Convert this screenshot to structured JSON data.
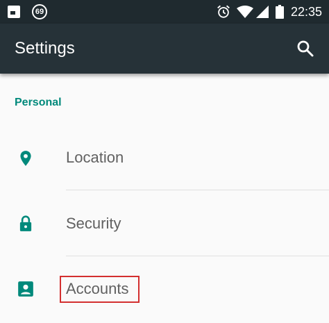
{
  "status_bar": {
    "notification_badge": "69",
    "time": "22:35",
    "icons": [
      "notification-icon",
      "alarm-icon",
      "wifi-icon",
      "signal-icon",
      "battery-icon"
    ]
  },
  "app_bar": {
    "title": "Settings",
    "search_icon": "search-icon"
  },
  "section": {
    "header": "Personal"
  },
  "items": [
    {
      "label": "Location",
      "icon": "location-pin-icon"
    },
    {
      "label": "Security",
      "icon": "lock-icon"
    },
    {
      "label": "Accounts",
      "icon": "account-box-icon",
      "highlighted": true
    }
  ],
  "colors": {
    "status_bar": "#1f2a2f",
    "app_bar": "#263238",
    "accent": "#00897b",
    "highlight_border": "#d32f2f"
  }
}
